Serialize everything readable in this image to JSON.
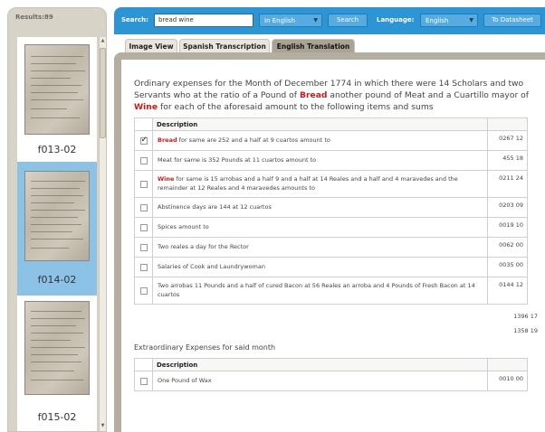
{
  "sidebar": {
    "results_label": "Results:89",
    "thumbnails": [
      {
        "caption": "f013-02",
        "selected": false
      },
      {
        "caption": "f014-02",
        "selected": true
      },
      {
        "caption": "f015-02",
        "selected": false
      }
    ]
  },
  "toolbar": {
    "search_label": "Search:",
    "search_value": "bread wine",
    "scope_select": "In English",
    "search_button": "Search",
    "language_label": "Language:",
    "language_select": "English",
    "datasheet_button": "To Datasheet"
  },
  "tabs": [
    "Image View",
    "Spanish Transcription",
    "English Translation"
  ],
  "active_tab": "English Translation",
  "heading": {
    "p1": "Ordinary expenses for the Month of December 1774 in which there were 14 Scholars and two Servants who at the ratio of a Pound of ",
    "kw1": "Bread",
    "p2": " another pound of Meat and a Cuartillo mayor of ",
    "kw2": "Wine",
    "p3": " for each of the aforesaid amount to the following items and sums"
  },
  "highlight_color": "#d01a1a",
  "accent_color": "#2e95d4",
  "ordinary_table": {
    "header": "Description",
    "rows": [
      {
        "checked": true,
        "keyword": "Bread",
        "text": " for same are 252 and a half at 9 cuartos amount to",
        "amount": "0267 12"
      },
      {
        "checked": false,
        "keyword": "",
        "text": "Meat for same is 352 Pounds at 11 cuartos amount to",
        "amount": "455 18"
      },
      {
        "checked": false,
        "keyword": "Wine",
        "text": " for same is 15 arrobas and a half 9 and a half at 14 Reales and a half and 4 maravedes and the remainder at 12 Reales and 4 maravedes amounts to",
        "amount": "0211 24"
      },
      {
        "checked": false,
        "keyword": "",
        "text": "Abstinence days are 144 at 12 cuartos",
        "amount": "0203 09"
      },
      {
        "checked": false,
        "keyword": "",
        "text": "Spices amount to",
        "amount": "0019 10"
      },
      {
        "checked": false,
        "keyword": "",
        "text": "Two reales a day for the Rector",
        "amount": "0062 00"
      },
      {
        "checked": false,
        "keyword": "",
        "text": "Salaries of Cook and Laundrywoman",
        "amount": "0035 00"
      },
      {
        "checked": false,
        "keyword": "",
        "text": "Two arrobas 11 Pounds and a half of cured Bacon at 56 Reales an arroba and 4 Pounds of Fresh Bacon at 14 cuartos",
        "amount": "0144 12"
      }
    ],
    "totals": [
      "1396 17",
      "1358 19"
    ]
  },
  "extra_section_title": "Extraordinary Expenses for said month",
  "extra_table": {
    "header": "Description",
    "rows": [
      {
        "checked": false,
        "keyword": "",
        "text": "One Pound of Wax",
        "amount": "0010 00"
      }
    ]
  }
}
